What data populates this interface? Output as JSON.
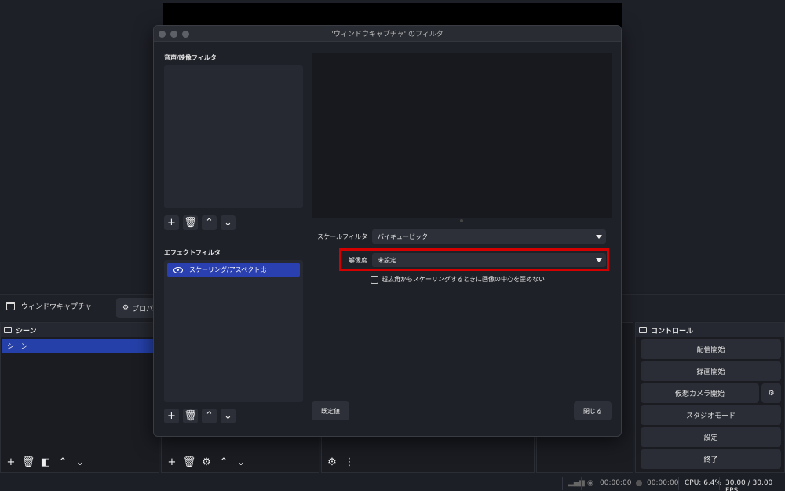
{
  "main": {
    "source_name": "ウィンドウキャプチャ",
    "properties_label": "プロパ",
    "scenes_dock": {
      "title": "シーン",
      "items": [
        "シーン"
      ]
    },
    "controls_dock": {
      "title": "コントロール",
      "buttons": {
        "stream": "配信開始",
        "record": "録画開始",
        "virtual_cam": "仮想カメラ開始",
        "studio": "スタジオモード",
        "settings": "設定",
        "exit": "終了"
      }
    },
    "status": {
      "rec_time": "00:00:00",
      "stream_time": "00:00:00",
      "cpu": "CPU: 6.4%",
      "fps": "30.00 / 30.00 FPS"
    }
  },
  "dialog": {
    "title": "'ウィンドウキャプチャ' のフィルタ",
    "audio_video_label": "音声/映像フィルタ",
    "effect_label": "エフェクトフィルタ",
    "effect_filters": [
      "スケーリング/アスペクト比"
    ],
    "props": {
      "scale_filter_label": "スケールフィルタ",
      "scale_filter_value": "バイキュービック",
      "resolution_label": "解像度",
      "resolution_value": "未設定",
      "checkbox_label": "超広角からスケーリングするときに画像の中心を歪めない"
    },
    "defaults_button": "既定値",
    "close_button": "閉じる"
  },
  "colors": {
    "accent": "#2b40b0",
    "highlight": "#d40000"
  }
}
